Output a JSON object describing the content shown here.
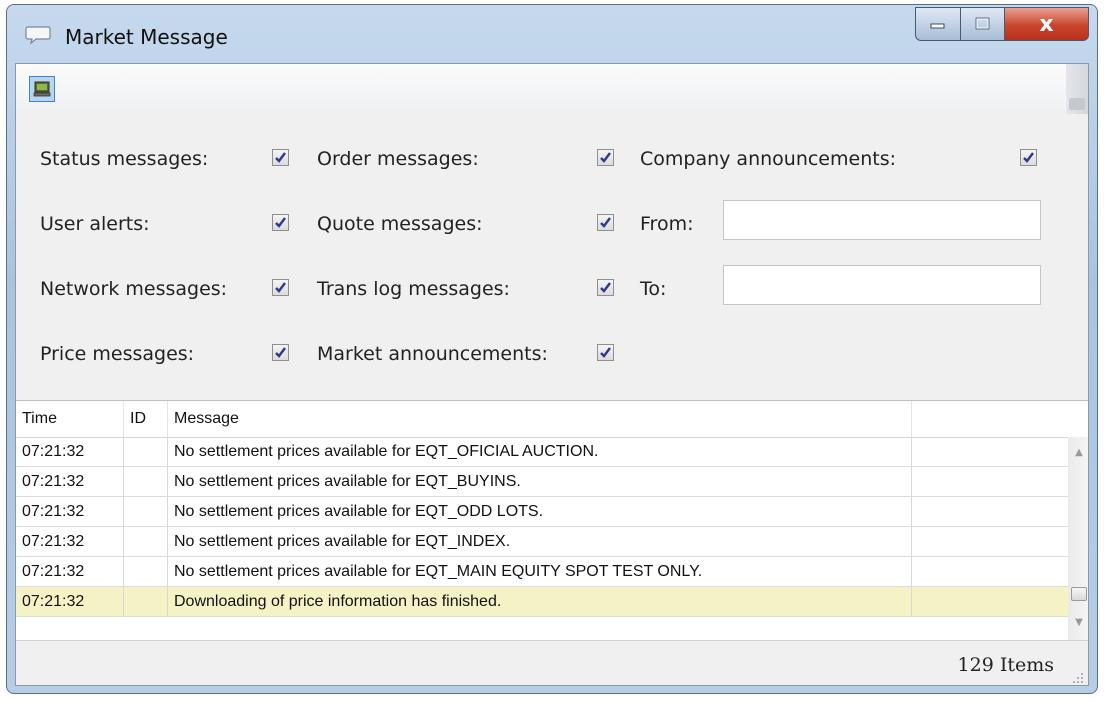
{
  "window": {
    "title": "Market Message",
    "minimize_label": "",
    "maximize_label": "",
    "close_label": "x"
  },
  "toolbar": {
    "icon": "monitor-icon"
  },
  "filters": {
    "status_label": "Status messages:",
    "status_checked": true,
    "user_alerts_label": "User alerts:",
    "user_alerts_checked": true,
    "network_label": "Network messages:",
    "network_checked": true,
    "price_label": "Price messages:",
    "price_checked": true,
    "order_label": "Order messages:",
    "order_checked": true,
    "quote_label": "Quote messages:",
    "quote_checked": true,
    "translog_label": "Trans log messages:",
    "translog_checked": true,
    "market_ann_label": "Market announcements:",
    "market_ann_checked": true,
    "company_ann_label": "Company announcements:",
    "company_ann_checked": true,
    "from_label": "From:",
    "from_value": "",
    "to_label": "To:",
    "to_value": ""
  },
  "grid": {
    "columns": [
      "Time",
      "ID",
      "Message",
      ""
    ],
    "rows": [
      {
        "time": "07:21:32",
        "id": "",
        "message": "No settlement prices available for EQT_OFICIAL AUCTION.",
        "selected": false
      },
      {
        "time": "07:21:32",
        "id": "",
        "message": "No settlement prices available for EQT_BUYINS.",
        "selected": false
      },
      {
        "time": "07:21:32",
        "id": "",
        "message": "No settlement prices available for EQT_ODD LOTS.",
        "selected": false
      },
      {
        "time": "07:21:32",
        "id": "",
        "message": "No settlement prices available for EQT_INDEX.",
        "selected": false
      },
      {
        "time": "07:21:32",
        "id": "",
        "message": "No settlement prices available for EQT_MAIN EQUITY SPOT TEST ONLY.",
        "selected": false
      },
      {
        "time": "07:21:32",
        "id": "",
        "message": "Downloading of price information has finished.",
        "selected": true
      }
    ],
    "selected_row_color": "#f5f3c5"
  },
  "status": {
    "count": "129 Items"
  }
}
